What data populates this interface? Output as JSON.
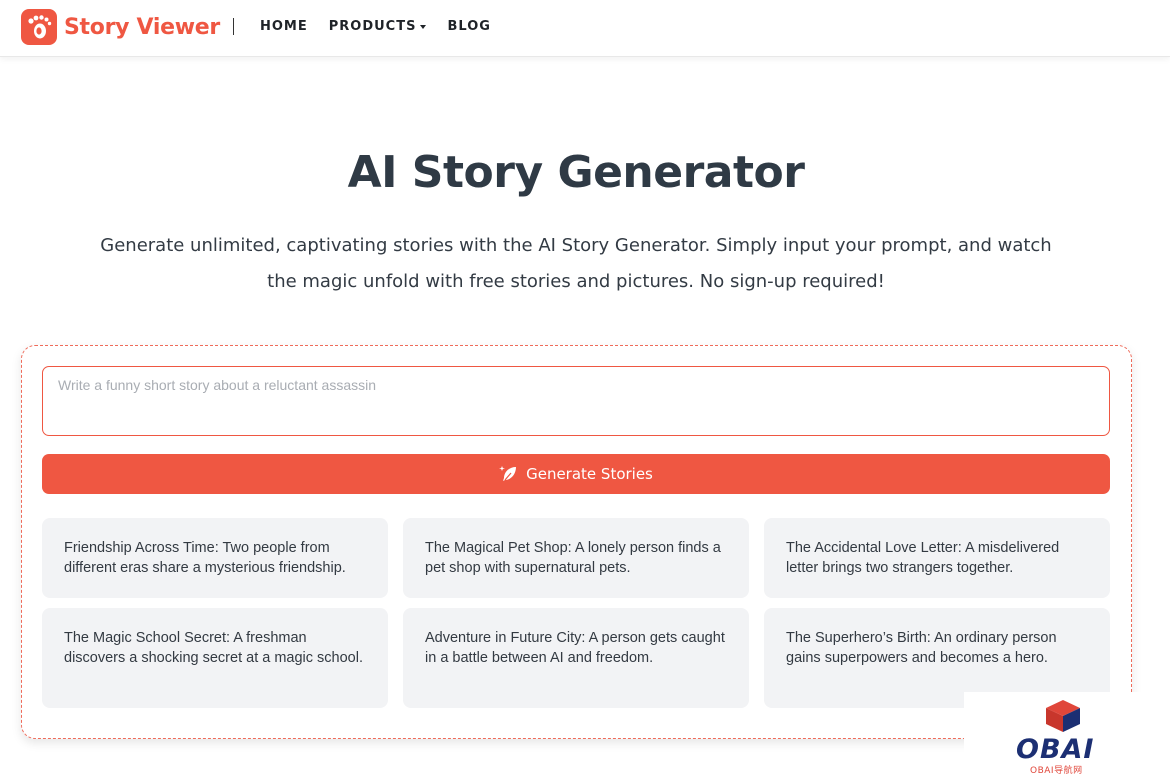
{
  "brand": {
    "name": "Story Viewer",
    "color": "#ef5742"
  },
  "nav": {
    "home": "HOME",
    "products": "PRODUCTS",
    "blog": "BLOG"
  },
  "hero": {
    "title": "AI Story Generator",
    "subtitle": "Generate unlimited, captivating stories with the AI Story Generator. Simply input your prompt, and watch the magic unfold with free stories and pictures. No sign-up required!"
  },
  "generator": {
    "prompt_value": "",
    "prompt_placeholder": "Write a funny short story about a reluctant assassin",
    "button_label": "Generate Stories",
    "button_icon": "feather-sparkle-icon"
  },
  "suggestions": [
    "Friendship Across Time: Two people from different eras share a mysterious friendship.",
    "The Magical Pet Shop: A lonely person finds a pet shop with supernatural pets.",
    "The Accidental Love Letter: A misdelivered letter brings two strangers together.",
    "The Magic School Secret: A freshman discovers a shocking secret at a magic school.",
    "Adventure in Future City: A person gets caught in a battle between AI and freedom.",
    "The Superhero’s Birth: An ordinary person gains superpowers and becomes a hero."
  ],
  "watermark": {
    "text": "OBAI",
    "sub": "OBAI导航网"
  }
}
